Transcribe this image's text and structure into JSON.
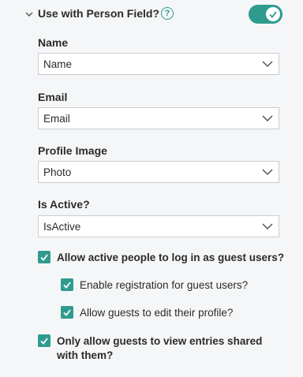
{
  "section": {
    "title": "Use with Person Field?",
    "help_icon": "question-circle-icon",
    "help_glyph": "?",
    "toggle_on": true,
    "accent_color": "#2f9b8f"
  },
  "fields": {
    "name": {
      "label": "Name",
      "value": "Name"
    },
    "email": {
      "label": "Email",
      "value": "Email"
    },
    "profile_image": {
      "label": "Profile Image",
      "value": "Photo"
    },
    "is_active": {
      "label": "Is Active?",
      "value": "IsActive"
    }
  },
  "options": {
    "guest_login": {
      "label": "Allow active people to log in as guest users?",
      "checked": true
    },
    "guest_registration": {
      "label": "Enable registration for guest users?",
      "checked": true
    },
    "guest_edit_profile": {
      "label": "Allow guests to edit their profile?",
      "checked": true
    },
    "shared_entries_line1": "Only allow guests to view entries shared",
    "shared_entries_line2": "with them?",
    "shared_entries_checked": true
  }
}
